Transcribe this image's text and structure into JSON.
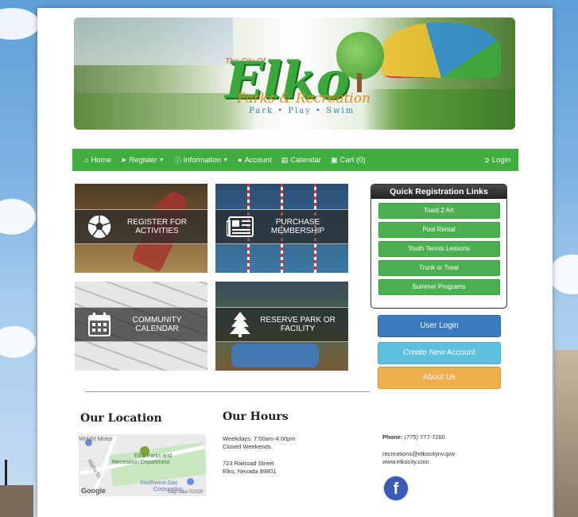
{
  "banner": {
    "city_of": "The City Of",
    "title": "Elko",
    "subtitle": "Parks & Recreation",
    "tagline": "Park • Play • Swim"
  },
  "nav": {
    "home": "Home",
    "register": "Register",
    "information": "Information",
    "account": "Account",
    "calendar": "Calendar",
    "cart": "Cart (0)",
    "login": "Login"
  },
  "tiles": [
    {
      "label": "REGISTER FOR ACTIVITIES",
      "icon": "soccer-ball-icon"
    },
    {
      "label": "PURCHASE MEMBERSHIP",
      "icon": "newspaper-icon"
    },
    {
      "label": "COMMUNITY CALENDAR",
      "icon": "calendar-icon"
    },
    {
      "label": "RESERVE PARK OR FACILITY",
      "icon": "tree-icon"
    }
  ],
  "quick_links": {
    "title": "Quick Registration Links",
    "items": [
      "Toast 2 Art",
      "Pool Rental",
      "Youth Tennis Lessons",
      "Trunk or Treat",
      "Summer Programs"
    ]
  },
  "buttons": {
    "user_login": "User Login",
    "create_account": "Create New Account",
    "about": "About Us"
  },
  "location": {
    "heading": "Our Location",
    "map_labels": {
      "wright": "Wright Motor",
      "park": "Elko Parks and",
      "park2": "Recreation Department",
      "street": "Idaho St",
      "gas": "Southwest Gas",
      "gas2": "Corporation",
      "google": "Google",
      "mapdata": "Map data ©2020"
    }
  },
  "hours": {
    "heading": "Our Hours",
    "weekdays": "Weekdays: 7:00am-4:00pm",
    "weekends": "Closed Weekends",
    "address1": "723 Railroad Street",
    "address2": "Elko, Nevada 89801"
  },
  "contact": {
    "phone_label": "Phone:",
    "phone": "(775) 777-7260",
    "email": "recreations@elkocitynv.gov",
    "website": "www.elkocity.com"
  },
  "colors": {
    "nav_green": "#3fae3f",
    "link_green": "#4caf50",
    "login_blue": "#3a7ac0",
    "create_cyan": "#5bc0de",
    "about_orange": "#f0ad4e"
  }
}
